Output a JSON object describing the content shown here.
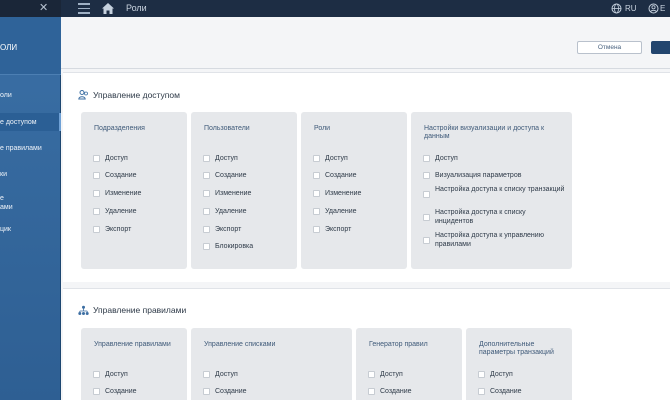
{
  "topbar": {
    "title": "Роли",
    "lang": "RU",
    "user_label": "E",
    "icons": [
      "close-icon",
      "menu-icon",
      "home-icon",
      "globe-icon",
      "user-icon"
    ]
  },
  "sidebar": {
    "header": "ОЛИ",
    "items": [
      {
        "label": "оли"
      },
      {
        "label": "е доступом"
      },
      {
        "label": "е правилами"
      },
      {
        "label": "ки"
      },
      {
        "label": "е\nами"
      },
      {
        "label": "цик"
      }
    ]
  },
  "header": {
    "cancel_label": "Отмена",
    "save_label": ""
  },
  "sections": [
    {
      "title": "Управление доступом",
      "icon": "users-icon",
      "cards": [
        {
          "title": "Подразделения",
          "options": [
            "Доступ",
            "Создание",
            "Изменение",
            "Удаление",
            "Экспорт"
          ]
        },
        {
          "title": "Пользователи",
          "options": [
            "Доступ",
            "Создание",
            "Изменение",
            "Удаление",
            "Экспорт",
            "Блокировка"
          ]
        },
        {
          "title": "Роли",
          "options": [
            "Доступ",
            "Создание",
            "Изменение",
            "Удаление",
            "Экспорт"
          ]
        },
        {
          "title": "Настройки визуализации и доступа к данным",
          "options": [
            "Доступ",
            "Визуализация параметров",
            "Настройка доступа к списку транзакций",
            "Настройка доступа к списку инцидентов",
            "Настройка доступа к управлению правилами"
          ]
        }
      ]
    },
    {
      "title": "Управление правилами",
      "icon": "hierarchy-icon",
      "cards": [
        {
          "title": "Управление правилами",
          "options": [
            "Доступ",
            "Создание"
          ]
        },
        {
          "title": "Управление списками",
          "options": [
            "Доступ",
            "Создание"
          ]
        },
        {
          "title": "Генератор правил",
          "options": [
            "Доступ",
            "Создание"
          ]
        },
        {
          "title": "Дополнительные параметры транзакций",
          "options": [
            "Доступ",
            "Создание"
          ]
        }
      ]
    }
  ]
}
